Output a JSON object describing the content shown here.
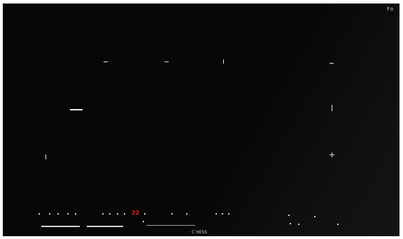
{
  "viewfinder": {
    "corner_indicator": "Fo",
    "red_value": "22",
    "bottom_label": "C HESS"
  },
  "colors": {
    "background": "#070707",
    "markers": "#e9e9e9",
    "warning": "#e1231b"
  }
}
